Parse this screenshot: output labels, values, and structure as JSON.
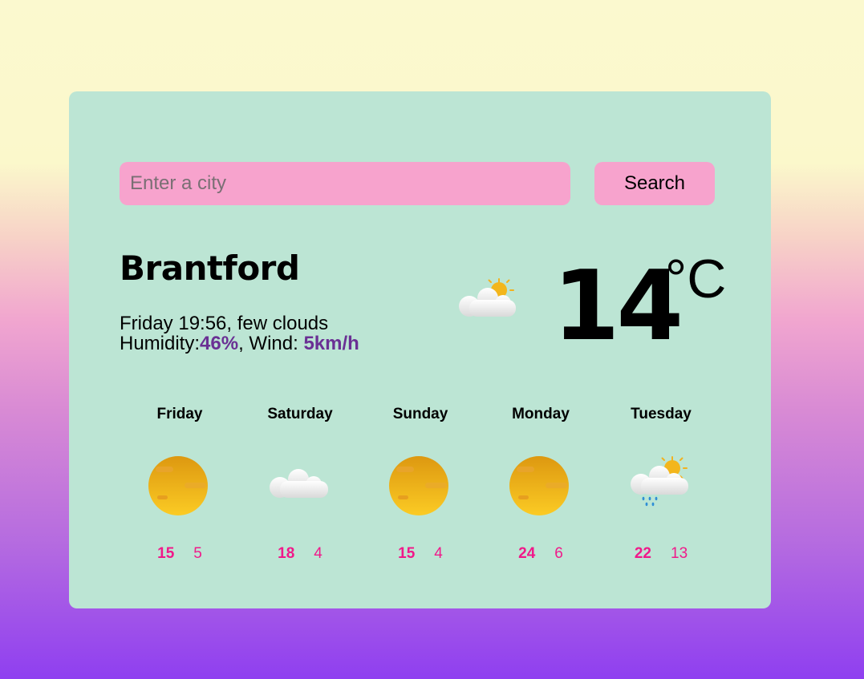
{
  "search": {
    "placeholder": "Enter a city",
    "value": "",
    "button_label": "Search"
  },
  "current": {
    "city": "Brantford",
    "day_time": "Friday 19:56",
    "description": "few clouds",
    "humidity_label": "Humidity:",
    "humidity": "46%",
    "wind_label": "Wind:",
    "wind": "5km/h",
    "temperature": "14",
    "unit": "°C",
    "icon": "few-clouds-icon"
  },
  "forecast": [
    {
      "day": "Friday",
      "max": "15",
      "min": "5",
      "icon": "clear-sky-icon"
    },
    {
      "day": "Saturday",
      "max": "18",
      "min": "4",
      "icon": "cloud-icon"
    },
    {
      "day": "Sunday",
      "max": "15",
      "min": "4",
      "icon": "clear-sky-icon"
    },
    {
      "day": "Monday",
      "max": "24",
      "min": "6",
      "icon": "clear-sky-icon"
    },
    {
      "day": "Tuesday",
      "max": "22",
      "min": "13",
      "icon": "rain-sun-icon"
    }
  ],
  "colors": {
    "card": "#bce5d4",
    "input": "#f7a3cd",
    "accent_text": "#6a3094",
    "temps": "#f0198a"
  }
}
